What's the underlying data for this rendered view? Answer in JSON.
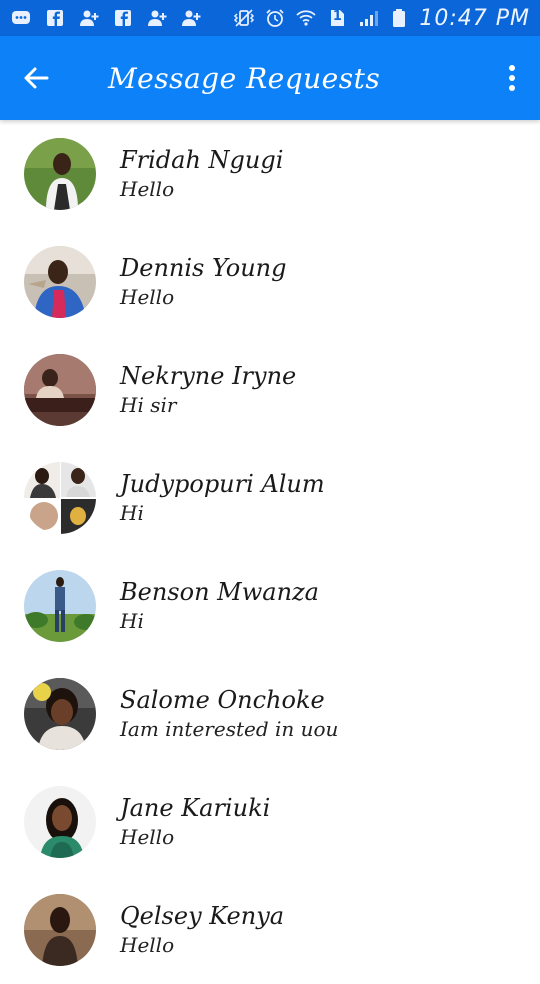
{
  "status_bar": {
    "time": "10:47 PM",
    "battery_badge": "1",
    "left_icons": [
      "messenger-icon",
      "facebook-icon",
      "add-friend-icon",
      "facebook-icon",
      "add-friend-icon",
      "add-friend-icon"
    ],
    "right_icons": [
      "vibrate-icon",
      "alarm-icon",
      "wifi-icon",
      "sim-icon",
      "signal-icon",
      "battery-icon"
    ]
  },
  "app_bar": {
    "title": "Message Requests",
    "back_icon": "back-arrow-icon",
    "menu_icon": "more-vert-icon",
    "color": "#0d82f8"
  },
  "requests": [
    {
      "name": "Fridah Ngugi",
      "message": "Hello"
    },
    {
      "name": "Dennis Young",
      "message": "Hello"
    },
    {
      "name": "Nekryne Iryne",
      "message": "Hi sir"
    },
    {
      "name": "Judypopuri Alum",
      "message": "Hi"
    },
    {
      "name": "Benson Mwanza",
      "message": "Hi"
    },
    {
      "name": "Salome Onchoke",
      "message": "Iam interested in uou"
    },
    {
      "name": "Jane Kariuki",
      "message": "Hello"
    },
    {
      "name": "Qelsey Kenya",
      "message": "Hello"
    }
  ]
}
